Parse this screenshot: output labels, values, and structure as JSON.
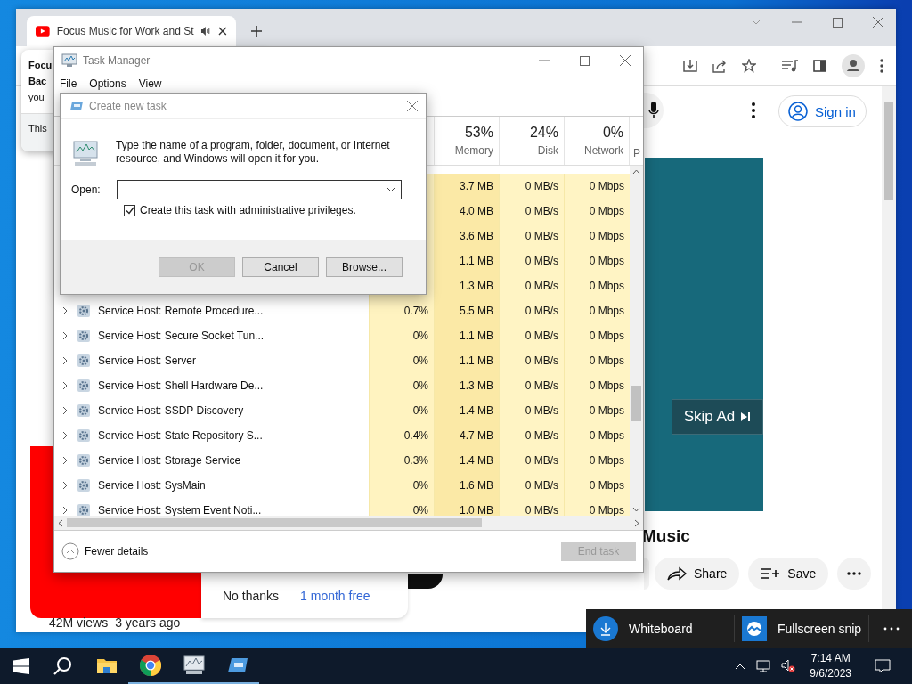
{
  "browser": {
    "tab": {
      "title": "Focus Music for Work and St",
      "audio": true
    },
    "hover_card": {
      "lines": [
        "Focu",
        "Bac",
        "you"
      ],
      "footer": "This"
    },
    "page": {
      "sign_in": "Sign in",
      "skip_ad": "Skip Ad",
      "video_title": "Music",
      "actions": [
        {
          "label": "Share",
          "kind": "share"
        },
        {
          "label": "Save",
          "kind": "save"
        }
      ],
      "premium": {
        "buttons": [
          "No thanks",
          "1 month free"
        ]
      },
      "views": "42M views",
      "age": "3 years ago"
    }
  },
  "task_manager": {
    "title": "Task Manager",
    "menu": [
      "File",
      "Options",
      "View"
    ],
    "columns": [
      {
        "percent": "53%",
        "label": "Memory"
      },
      {
        "percent": "24%",
        "label": "Disk"
      },
      {
        "percent": "0%",
        "label": "Network"
      }
    ],
    "column_5": "P",
    "rows": [
      {
        "memory": "3.7 MB",
        "disk": "0 MB/s",
        "network": "0 Mbps"
      },
      {
        "memory": "4.0 MB",
        "disk": "0 MB/s",
        "network": "0 Mbps"
      },
      {
        "memory": "3.6 MB",
        "disk": "0 MB/s",
        "network": "0 Mbps"
      },
      {
        "memory": "1.1 MB",
        "disk": "0 MB/s",
        "network": "0 Mbps"
      },
      {
        "memory": "1.3 MB",
        "disk": "0 MB/s",
        "network": "0 Mbps"
      },
      {
        "name": "Service Host: Remote Procedure...",
        "cpu": "0.7%",
        "memory": "5.5 MB",
        "disk": "0 MB/s",
        "network": "0 Mbps"
      },
      {
        "name": "Service Host: Secure Socket Tun...",
        "cpu": "0%",
        "memory": "1.1 MB",
        "disk": "0 MB/s",
        "network": "0 Mbps"
      },
      {
        "name": "Service Host: Server",
        "cpu": "0%",
        "memory": "1.1 MB",
        "disk": "0 MB/s",
        "network": "0 Mbps"
      },
      {
        "name": "Service Host: Shell Hardware De...",
        "cpu": "0%",
        "memory": "1.3 MB",
        "disk": "0 MB/s",
        "network": "0 Mbps"
      },
      {
        "name": "Service Host: SSDP Discovery",
        "cpu": "0%",
        "memory": "1.4 MB",
        "disk": "0 MB/s",
        "network": "0 Mbps"
      },
      {
        "name": "Service Host: State Repository S...",
        "cpu": "0.4%",
        "memory": "4.7 MB",
        "disk": "0 MB/s",
        "network": "0 Mbps"
      },
      {
        "name": "Service Host: Storage Service",
        "cpu": "0.3%",
        "memory": "1.4 MB",
        "disk": "0 MB/s",
        "network": "0 Mbps"
      },
      {
        "name": "Service Host: SysMain",
        "cpu": "0%",
        "memory": "1.6 MB",
        "disk": "0 MB/s",
        "network": "0 Mbps"
      },
      {
        "name": "Service Host: System Event Noti...",
        "cpu": "0%",
        "memory": "1.0 MB",
        "disk": "0 MB/s",
        "network": "0 Mbps"
      }
    ],
    "fewer_details": "Fewer details",
    "end_task": {
      "label": "End task",
      "disabled": true
    }
  },
  "dialog": {
    "title": "Create new task",
    "message": "Type the name of a program, folder, document, or Internet resource, and Windows will open it for you.",
    "open_label": "Open:",
    "admin": {
      "label": "Create this task with administrative privileges.",
      "checked": true
    },
    "buttons": [
      {
        "label": "OK",
        "disabled": true
      },
      {
        "label": "Cancel",
        "disabled": false
      },
      {
        "label": "Browse...",
        "disabled": false
      }
    ]
  },
  "toast": [
    {
      "label": "Whiteboard",
      "kind": "download"
    },
    {
      "label": "Fullscreen snip",
      "kind": "snip"
    }
  ],
  "taskbar": {
    "apps": [
      {
        "kind": "explorer",
        "running": false
      },
      {
        "kind": "chrome",
        "running": true
      },
      {
        "kind": "taskmgr",
        "running": true
      },
      {
        "kind": "run",
        "running": true
      }
    ],
    "time": "7:14 AM",
    "date": "9/6/2023"
  }
}
